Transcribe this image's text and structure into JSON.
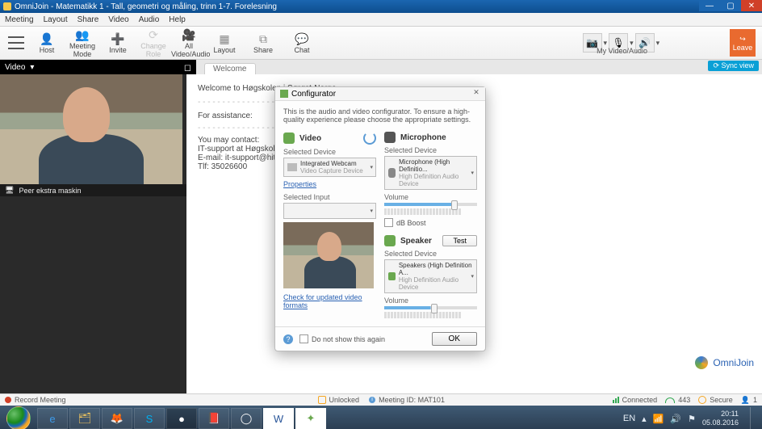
{
  "window": {
    "title": "OmniJoin - Matematikk 1 - Tall, geometri og måling, trinn 1-7. Forelesning"
  },
  "menu": {
    "meeting": "Meeting",
    "layout": "Layout",
    "share": "Share",
    "video": "Video",
    "audio": "Audio",
    "help": "Help"
  },
  "toolbar": {
    "host": "Host",
    "meeting_mode": "Meeting Mode",
    "invite": "Invite",
    "change_role": "Change Role",
    "all_video_audio": "All Video/Audio",
    "layout": "Layout",
    "share": "Share",
    "chat": "Chat",
    "my_video_audio": "My Video/Audio",
    "leave": "Leave"
  },
  "sidebar": {
    "video_tab": "Video",
    "participant_label": "Peer ekstra maskin"
  },
  "main": {
    "tab_label": "Welcome",
    "welcome_line": "Welcome to Høgskolen i Sørøst-Norge",
    "assist_label": "For assistance:",
    "contact_label": "You may contact:",
    "contact_l1": "IT-support at Høgskolen i Sør...",
    "contact_l2": "E-mail: it-support@hit.no",
    "contact_l3": "Tlf: 35026600",
    "brand": "OmniJoin",
    "sync_view": "Sync view"
  },
  "dialog": {
    "title": "Configurator",
    "intro": "This is the audio and video configurator. To ensure a high-quality experience please choose the appropriate settings.",
    "video_section": "Video",
    "selected_device": "Selected Device",
    "vid_sel_l1": "Integrated Webcam",
    "vid_sel_l2": "Video Capture Device",
    "properties": "Properties",
    "selected_input": "Selected Input",
    "check_formats": "Check for updated video formats",
    "mic_section": "Microphone",
    "mic_sel_l1": "Microphone (High Definitio...",
    "mic_sel_l2": "High Definition Audio Device",
    "volume": "Volume",
    "db_boost": "dB Boost",
    "speaker_section": "Speaker",
    "test": "Test",
    "spk_sel_l1": "Speakers (High Definition A...",
    "spk_sel_l2": "High Definition Audio Device",
    "donotshow": "Do not show this again",
    "ok": "OK"
  },
  "status": {
    "record": "Record Meeting",
    "unlocked": "Unlocked",
    "meeting_id": "Meeting ID: MAT101",
    "connected": "Connected",
    "secure": "Secure",
    "bitrate": "443",
    "count": "1"
  },
  "taskbar": {
    "lang": "EN",
    "time": "20:11",
    "date": "05.08.2016"
  }
}
